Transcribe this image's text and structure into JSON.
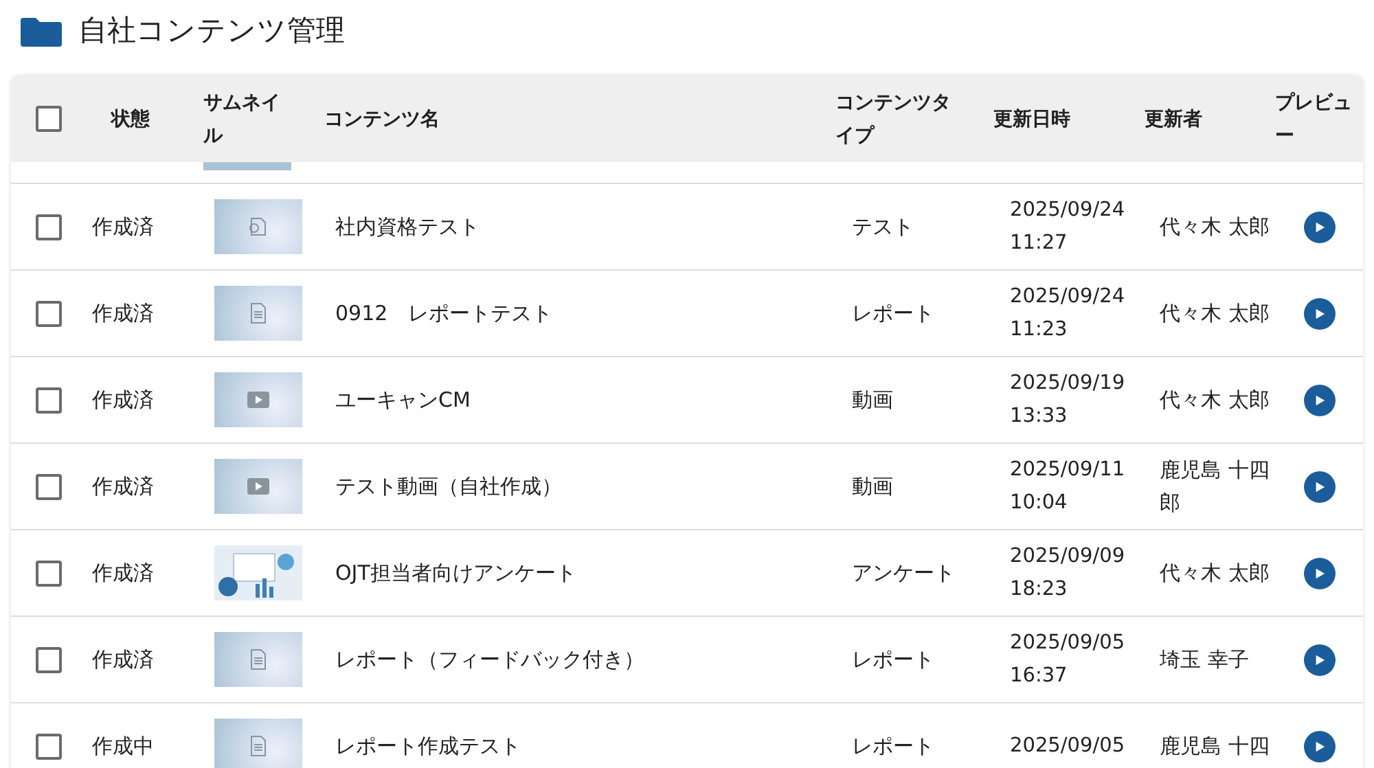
{
  "title": "自社コンテンツ管理",
  "columns": [
    {
      "kind": "checkbox",
      "checked": false
    },
    {
      "kind": "text",
      "label": "状態"
    },
    {
      "kind": "text",
      "label": "サムネイル"
    },
    {
      "kind": "text",
      "label": "コンテンツ名"
    },
    {
      "kind": "text",
      "label": "コンテンツタイプ"
    },
    {
      "kind": "text",
      "label": "更新日時"
    },
    {
      "kind": "text",
      "label": "更新者"
    },
    {
      "kind": "text",
      "label": "プレビュー"
    }
  ],
  "rows": [
    {
      "checked": false,
      "status": "作成済",
      "thumbnail": {
        "kind": "test"
      },
      "name": "社内資格テスト",
      "type": "テスト",
      "updated": [
        "2025/09/24",
        "11:27"
      ],
      "updater": "代々木 太郎"
    },
    {
      "checked": false,
      "status": "作成済",
      "thumbnail": {
        "kind": "report"
      },
      "name": "0912　レポートテスト",
      "type": "レポート",
      "updated": [
        "2025/09/24",
        "11:23"
      ],
      "updater": "代々木 太郎"
    },
    {
      "checked": false,
      "status": "作成済",
      "thumbnail": {
        "kind": "video"
      },
      "name": "ユーキャンCM",
      "type": "動画",
      "updated": [
        "2025/09/19",
        "13:33"
      ],
      "updater": "代々木 太郎"
    },
    {
      "checked": false,
      "status": "作成済",
      "thumbnail": {
        "kind": "video"
      },
      "name": "テスト動画（自社作成）",
      "type": "動画",
      "updated": [
        "2025/09/11",
        "10:04"
      ],
      "updater": "鹿児島 十四郎"
    },
    {
      "checked": false,
      "status": "作成済",
      "thumbnail": {
        "kind": "photo"
      },
      "name": "OJT担当者向けアンケート",
      "type": "アンケート",
      "updated": [
        "2025/09/09",
        "18:23"
      ],
      "updater": "代々木 太郎"
    },
    {
      "checked": false,
      "status": "作成済",
      "thumbnail": {
        "kind": "report"
      },
      "name": "レポート（フィードバック付き）",
      "type": "レポート",
      "updated": [
        "2025/09/05",
        "16:37"
      ],
      "updater": "埼玉 幸子"
    },
    {
      "checked": false,
      "status": "作成中",
      "thumbnail": {
        "kind": "report"
      },
      "name": "レポート作成テスト",
      "type": "レポート",
      "updated": [
        "2025/09/05"
      ],
      "updater": "鹿児島 十四"
    }
  ]
}
